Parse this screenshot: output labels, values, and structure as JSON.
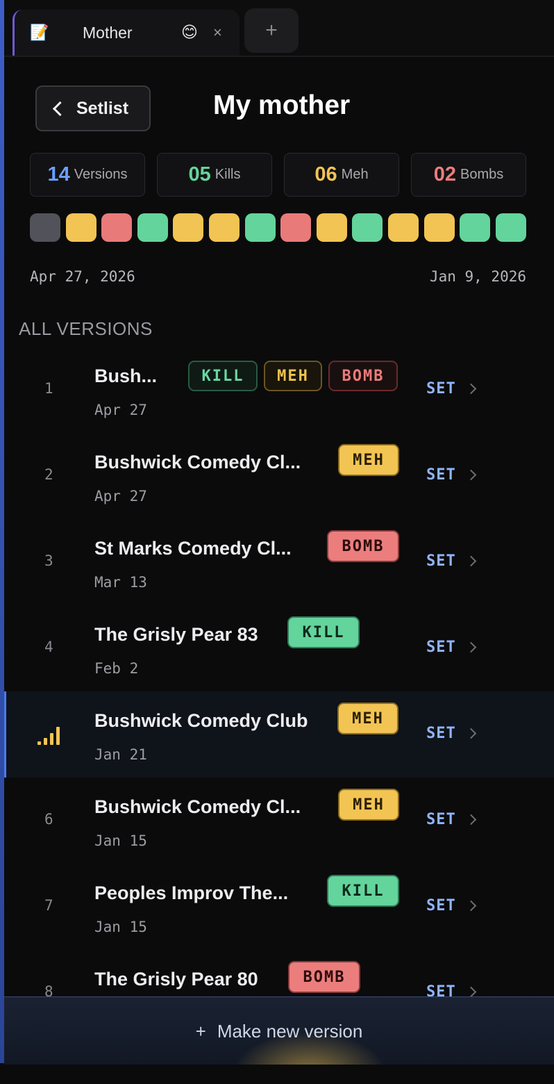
{
  "tab": {
    "icon": "📝",
    "title": "Mother",
    "emoji": "😊",
    "close": "×"
  },
  "tab_add": "+",
  "header": {
    "back_label": "Setlist",
    "title": "My mother"
  },
  "stats": [
    {
      "num": "14",
      "label": "Versions",
      "color": "#6aa0ff"
    },
    {
      "num": "05",
      "label": "Kills",
      "color": "#63d49c"
    },
    {
      "num": "06",
      "label": "Meh",
      "color": "#f2c453"
    },
    {
      "num": "02",
      "label": "Bombs",
      "color": "#ec7d7d"
    }
  ],
  "timeline_colors": {
    "gray": "#52525a",
    "kill": "#63d49c",
    "meh": "#f2c453",
    "bomb": "#e97a7a"
  },
  "timeline": [
    "gray",
    "meh",
    "bomb",
    "kill",
    "meh",
    "meh",
    "kill",
    "bomb",
    "meh",
    "kill",
    "meh",
    "meh",
    "kill",
    "kill"
  ],
  "date_start": "Apr 27, 2026",
  "date_end": "Jan 9, 2026",
  "section_title": "ALL VERSIONS",
  "versions": [
    {
      "num": "1",
      "name": "Bush...",
      "date": "Apr 27",
      "set": "SET"
    },
    {
      "num": "2",
      "name": "Bushwick Comedy Cl...",
      "date": "Apr 27",
      "set": "SET"
    },
    {
      "num": "3",
      "name": "St Marks Comedy Cl...",
      "date": "Mar 13",
      "set": "SET"
    },
    {
      "num": "4",
      "name": "The Grisly Pear 83",
      "date": "Feb 2",
      "set": "SET"
    },
    {
      "num": "",
      "name": "Bushwick Comedy Club",
      "date": "Jan 21",
      "set": "SET",
      "current": true
    },
    {
      "num": "6",
      "name": "Bushwick Comedy Cl...",
      "date": "Jan 15",
      "set": "SET"
    },
    {
      "num": "7",
      "name": "Peoples Improv The...",
      "date": "Jan 15",
      "set": "SET"
    },
    {
      "num": "8",
      "name": "The Grisly Pear 80",
      "date": "",
      "set": "SET"
    }
  ],
  "tags": {
    "kill": "KILL",
    "meh": "MEH",
    "bomb": "BOMB"
  },
  "new_version_label": "Make new version",
  "new_version_icon": "+"
}
